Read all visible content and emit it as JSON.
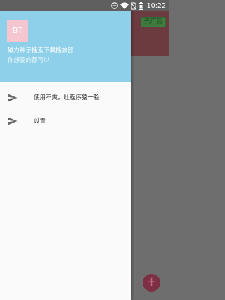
{
  "status_bar": {
    "time": "10:22",
    "icons": [
      "minus-circle-icon",
      "wifi-icon",
      "no-sim-icon",
      "battery-icon"
    ]
  },
  "app_behind": {
    "ad_label": "去广告",
    "fab_label": "+",
    "accent_color": "#6c3b3f",
    "fab_color": "#7d3044"
  },
  "drawer": {
    "header": {
      "avatar_text": "BT",
      "title": "磁力种子搜索下载播放器",
      "subtitle": "你想要的都可以",
      "bg_color": "#8ed0ea",
      "avatar_color": "#f5c6cf"
    },
    "items": [
      {
        "label": "使用不爽，吐程序猿一脸",
        "icon": "send-icon"
      },
      {
        "label": "设置",
        "icon": "send-icon"
      }
    ]
  }
}
